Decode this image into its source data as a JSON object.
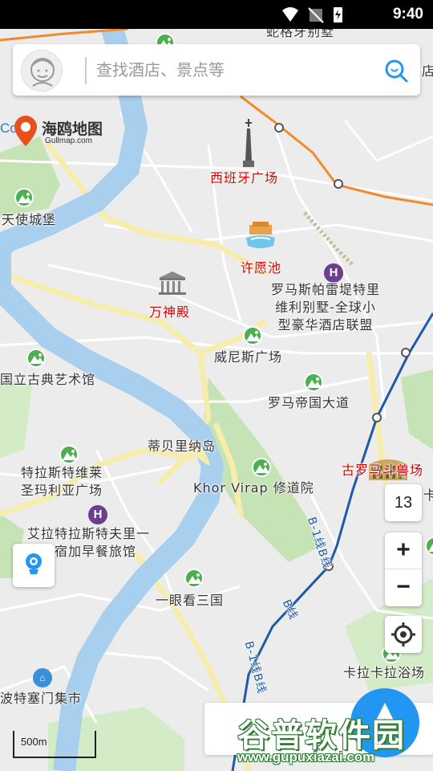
{
  "status_bar": {
    "time": "9:40"
  },
  "search": {
    "placeholder": "查找酒店、景点等"
  },
  "logo": {
    "prefix": "Com",
    "brand": "海鸥地图",
    "domain": "Gullmap.com"
  },
  "map": {
    "labels": {
      "top_clip": "蛇格牙别墅",
      "spain_square": "西班牙广场",
      "castel": "天使城堡",
      "trevi": "许愿池",
      "pantheon": "万神殿",
      "hotel": "罗马斯帕雷堤特里\n维利别墅-全球小\n型豪华酒店联盟",
      "venezia": "威尼斯广场",
      "museum": "国立古典艺术馆",
      "imperial": "罗马帝国大道",
      "tiber_island": "蒂贝里纳岛",
      "trastevere_square": "特拉斯特维莱\n圣玛利亚广场",
      "colosseum": "古罗马斗兽场",
      "khor_virap": "Khor Virap 修道院",
      "bnb": "艾拉特拉斯特夫里一\n住宿加早餐旅馆",
      "yiyan": "一眼看三国",
      "caracalla": "卡拉卡拉浴场",
      "porta_portese": "波特塞门集市",
      "right_clip_1": "店",
      "right_clip_2": "卡"
    },
    "metro_labels": {
      "b1_a": "B-1线B线",
      "b_a": "B线",
      "b1_b": "B-1线B线"
    },
    "zoom_level": "13",
    "scale": "500m"
  },
  "controls": {
    "zoom_in": "+",
    "zoom_out": "−"
  },
  "watermark": {
    "title": "谷普软件园",
    "url": "www.gupuxiazai.com"
  },
  "colors": {
    "river": "#a9cfee",
    "main_road": "#f6ecac",
    "park": "#c5e3b5",
    "metro": "#1e5aa8",
    "rail": "#f08a2c",
    "accent": "#2196f3"
  }
}
